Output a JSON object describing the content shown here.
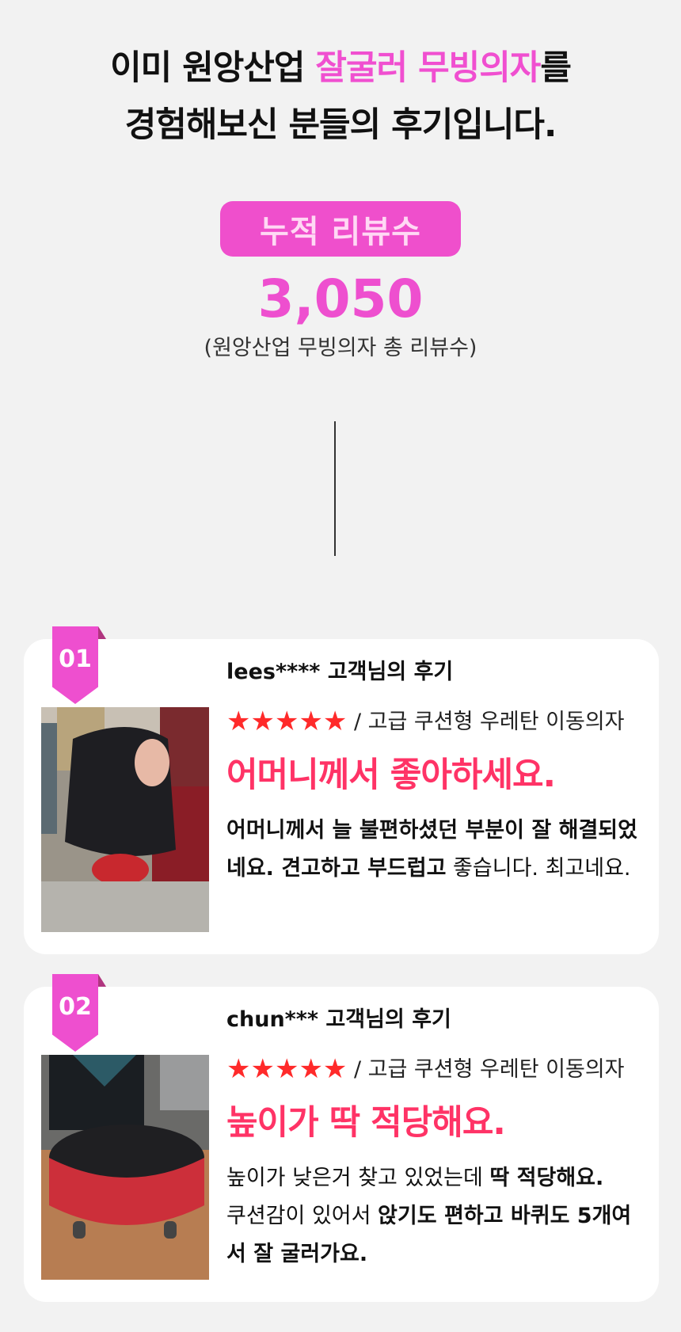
{
  "headline": {
    "line1_prefix": "이미 원앙산업 ",
    "line1_highlight": "잘굴러 무빙의자",
    "line1_suffix": "를",
    "line2": "경험해보신 분들의 후기입니다."
  },
  "summary": {
    "badge_label": "누적 리뷰수",
    "count": "3,050",
    "caption": "(원앙산업 무빙의자 총 리뷰수)"
  },
  "reviews": [
    {
      "number": "01",
      "reviewer": "lees**** 고객님의 후기",
      "stars": "★★★★★",
      "product": " / 고급 쿠션형 우레탄 이동의자",
      "title": "어머니께서 좋아하세요.",
      "body_1_bold": "어머니께서 늘 불편하셨던 부분이 잘 해결되었네요. 견고하고 부드럽고",
      "body_1_regular": " 좋습니다. 최고네요."
    },
    {
      "number": "02",
      "reviewer": "chun*** 고객님의 후기",
      "stars": "★★★★★",
      "product": " / 고급 쿠션형 우레탄 이동의자",
      "title": "높이가 딱 적당해요.",
      "body_1_regular": "높이가 낮은거 찾고 있었는데 ",
      "body_1_bold": "딱 적당해요.",
      "body_2_regular": "쿠션감이 있어서 ",
      "body_2_bold": "앉기도 편하고 바퀴도 5개여서 잘 굴러가요."
    }
  ],
  "colors": {
    "accent_pink": "#ee4fcf",
    "title_red": "#ff3366",
    "star_red": "#ff2a2a",
    "background": "#f2f2f2"
  }
}
